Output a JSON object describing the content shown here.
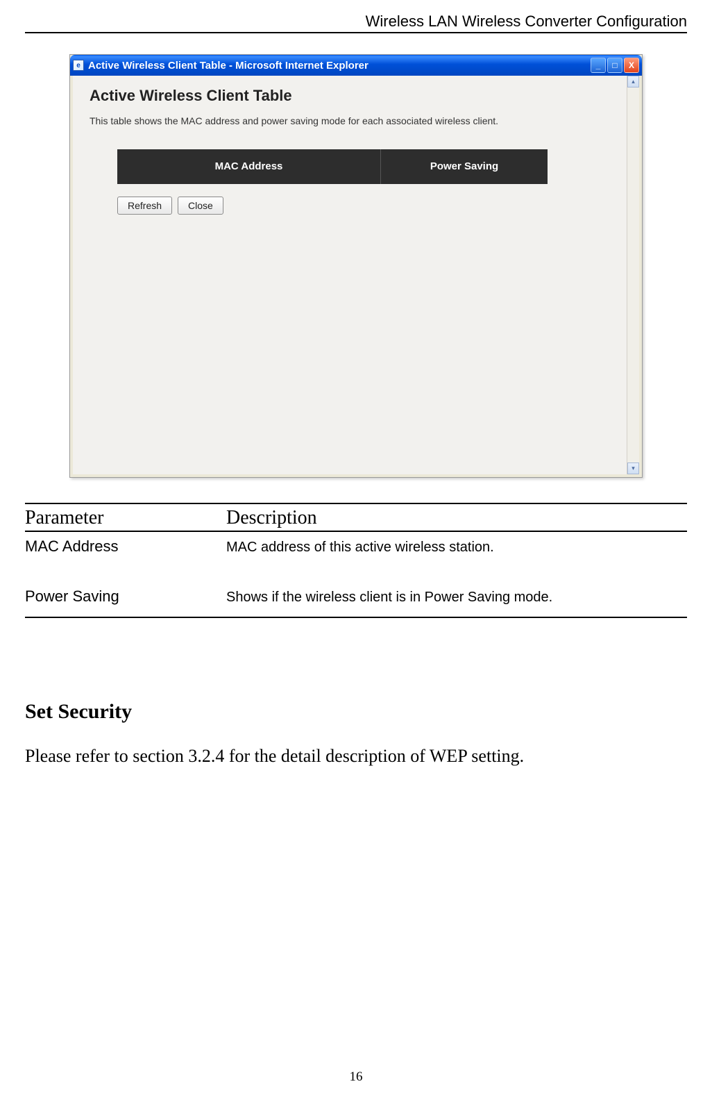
{
  "header": {
    "text": "Wireless LAN Wireless Converter Configuration"
  },
  "window": {
    "title": "Active Wireless Client Table - Microsoft Internet Explorer",
    "controls": {
      "minimize": "_",
      "maximize": "□",
      "close": "X"
    }
  },
  "content": {
    "title": "Active Wireless Client Table",
    "description": "This table shows the MAC address and power saving mode for each associated wireless client.",
    "table_headers": {
      "mac": "MAC Address",
      "power": "Power Saving"
    },
    "buttons": {
      "refresh": "Refresh",
      "close": "Close"
    }
  },
  "param_table": {
    "col_headers": {
      "param": "Parameter",
      "desc": "Description"
    },
    "rows": [
      {
        "param": "MAC Address",
        "desc": "MAC address of this active wireless station."
      },
      {
        "param": "Power Saving",
        "desc": "Shows if the wireless client is in Power Saving mode."
      }
    ]
  },
  "section": {
    "heading": "Set Security",
    "body": "Please refer to section 3.2.4 for the detail description of WEP setting."
  },
  "page_number": "16"
}
